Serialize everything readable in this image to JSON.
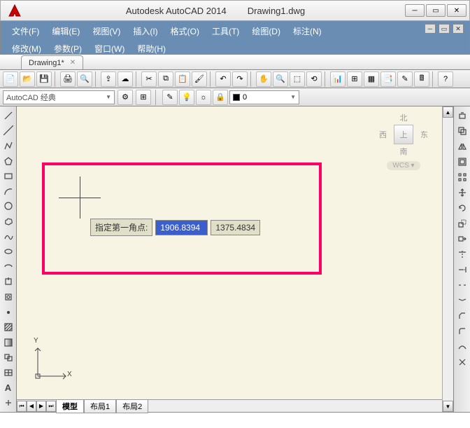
{
  "titlebar": {
    "app_name": "Autodesk AutoCAD 2014",
    "doc_name": "Drawing1.dwg"
  },
  "menus": {
    "file": "文件(F)",
    "edit": "编辑(E)",
    "view": "视图(V)",
    "insert": "插入(I)",
    "format": "格式(O)",
    "tools": "工具(T)",
    "draw": "绘图(D)",
    "dimension": "标注(N)",
    "modify": "修改(M)",
    "parametric": "参数(P)",
    "window": "窗口(W)",
    "help": "帮助(H)"
  },
  "document_tab": {
    "label": "Drawing1*"
  },
  "workspace": {
    "current": "AutoCAD 经典"
  },
  "layer": {
    "current": "0"
  },
  "viewcube": {
    "north": "北",
    "south": "南",
    "east": "东",
    "west": "西",
    "top": "上",
    "wcs": "WCS"
  },
  "prompt": {
    "label": "指定第一角点:",
    "x_value": "1906.8394",
    "y_value": "1375.4834"
  },
  "ucs": {
    "x": "X",
    "y": "Y"
  },
  "model_tabs": {
    "model": "模型",
    "layout1": "布局1",
    "layout2": "布局2"
  }
}
